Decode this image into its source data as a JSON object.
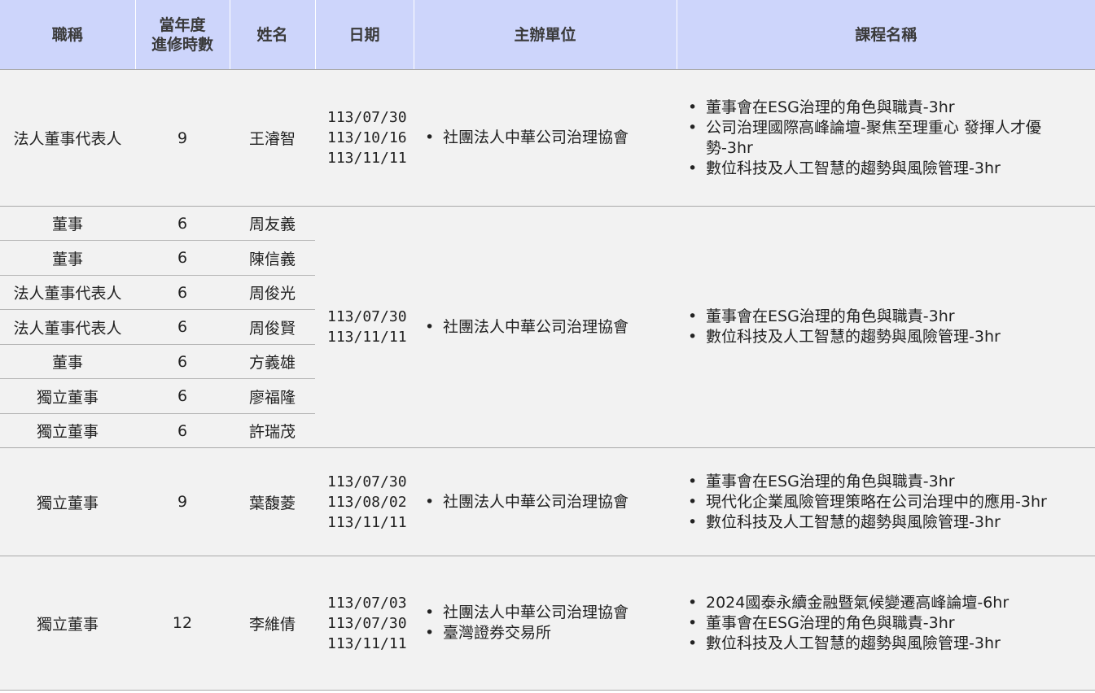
{
  "headers": {
    "title": "職稱",
    "hours_line1": "當年度",
    "hours_line2": "進修時數",
    "name": "姓名",
    "date": "日期",
    "organizer": "主辦單位",
    "course": "課程名稱"
  },
  "groups": [
    {
      "rows": [
        {
          "title": "法人董事代表人",
          "hours": "9",
          "name": "王濬智"
        }
      ],
      "dates": [
        "113/07/30",
        "113/10/16",
        "113/11/11"
      ],
      "organizers": [
        "社團法人中華公司治理協會"
      ],
      "courses": [
        "董事會在ESG治理的角色與職責-3hr",
        "公司治理國際高峰論壇-聚焦至理重心  發揮人才優勢-3hr",
        "數位科技及人工智慧的趨勢與風險管理-3hr"
      ]
    },
    {
      "rows": [
        {
          "title": "董事",
          "hours": "6",
          "name": "周友義"
        },
        {
          "title": "董事",
          "hours": "6",
          "name": "陳信義"
        },
        {
          "title": "法人董事代表人",
          "hours": "6",
          "name": "周俊光"
        },
        {
          "title": "法人董事代表人",
          "hours": "6",
          "name": "周俊賢"
        },
        {
          "title": "董事",
          "hours": "6",
          "name": "方義雄"
        },
        {
          "title": "獨立董事",
          "hours": "6",
          "name": "廖福隆"
        },
        {
          "title": "獨立董事",
          "hours": "6",
          "name": "許瑞茂"
        }
      ],
      "dates": [
        "113/07/30",
        "113/11/11"
      ],
      "organizers": [
        "社團法人中華公司治理協會"
      ],
      "courses": [
        "董事會在ESG治理的角色與職責-3hr",
        "數位科技及人工智慧的趨勢與風險管理-3hr"
      ]
    },
    {
      "rows": [
        {
          "title": "獨立董事",
          "hours": "9",
          "name": "葉馥菱"
        }
      ],
      "dates": [
        "113/07/30",
        "113/08/02",
        "113/11/11"
      ],
      "organizers": [
        "社團法人中華公司治理協會"
      ],
      "courses": [
        "董事會在ESG治理的角色與職責-3hr",
        "現代化企業風險管理策略在公司治理中的應用-3hr",
        "數位科技及人工智慧的趨勢與風險管理-3hr"
      ]
    },
    {
      "rows": [
        {
          "title": "獨立董事",
          "hours": "12",
          "name": "李維倩"
        }
      ],
      "dates": [
        "113/07/03",
        "113/07/30",
        "113/11/11"
      ],
      "organizers": [
        "社團法人中華公司治理協會",
        "臺灣證券交易所"
      ],
      "courses": [
        "2024國泰永續金融暨氣候變遷高峰論壇-6hr",
        "董事會在ESG治理的角色與職責-3hr",
        "數位科技及人工智慧的趨勢與風險管理-3hr"
      ]
    }
  ]
}
